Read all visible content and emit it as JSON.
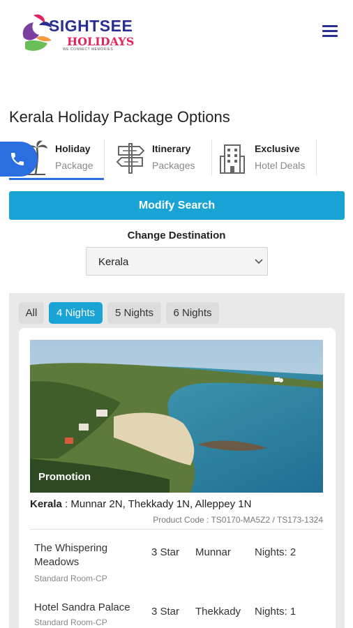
{
  "header": {
    "logo_brand": "SIGHTSEE",
    "logo_sub": "HOLIDAYS",
    "logo_tagline": "WE CONNECT MEMORIES",
    "menu_icon": "hamburger-menu-icon"
  },
  "page_title": "Kerala Holiday Package Options",
  "tabs": [
    {
      "title": "Holiday",
      "subtitle": "Package",
      "icon": "palm-tree-icon",
      "active": true
    },
    {
      "title": "Itinerary",
      "subtitle": "Packages",
      "icon": "signpost-icon",
      "active": false
    },
    {
      "title": "Exclusive",
      "subtitle": "Hotel Deals",
      "icon": "hotel-building-icon",
      "active": false
    }
  ],
  "call_button": {
    "icon": "phone-icon"
  },
  "modify_search_label": "Modify Search",
  "destination": {
    "label": "Change Destination",
    "selected": "Kerala",
    "icon": "chevron-down-icon"
  },
  "filters": [
    {
      "label": "All",
      "active": false
    },
    {
      "label": "4 Nights",
      "active": true
    },
    {
      "label": "5 Nights",
      "active": false
    },
    {
      "label": "6 Nights",
      "active": false
    }
  ],
  "package": {
    "badge": "Promotion",
    "state": "Kerala",
    "route": " : Munnar 2N, Thekkady 1N, Alleppey 1N",
    "product_code": "Product Code : TS0170-MA5Z2 / TS173-1324",
    "hotels": [
      {
        "name": "The Whispering Meadows",
        "room": "Standard Room-CP",
        "star": "3 Star",
        "city": "Munnar",
        "nights": "Nights: 2"
      },
      {
        "name": "Hotel Sandra Palace",
        "room": "Standard Room-CP",
        "star": "3 Star",
        "city": "Thekkady",
        "nights": "Nights: 1"
      }
    ]
  },
  "colors": {
    "accent": "#1aa4d6",
    "brand": "#2a2f8f",
    "tab_underline": "#2a6ee0",
    "call_button": "#2a6ee0"
  }
}
